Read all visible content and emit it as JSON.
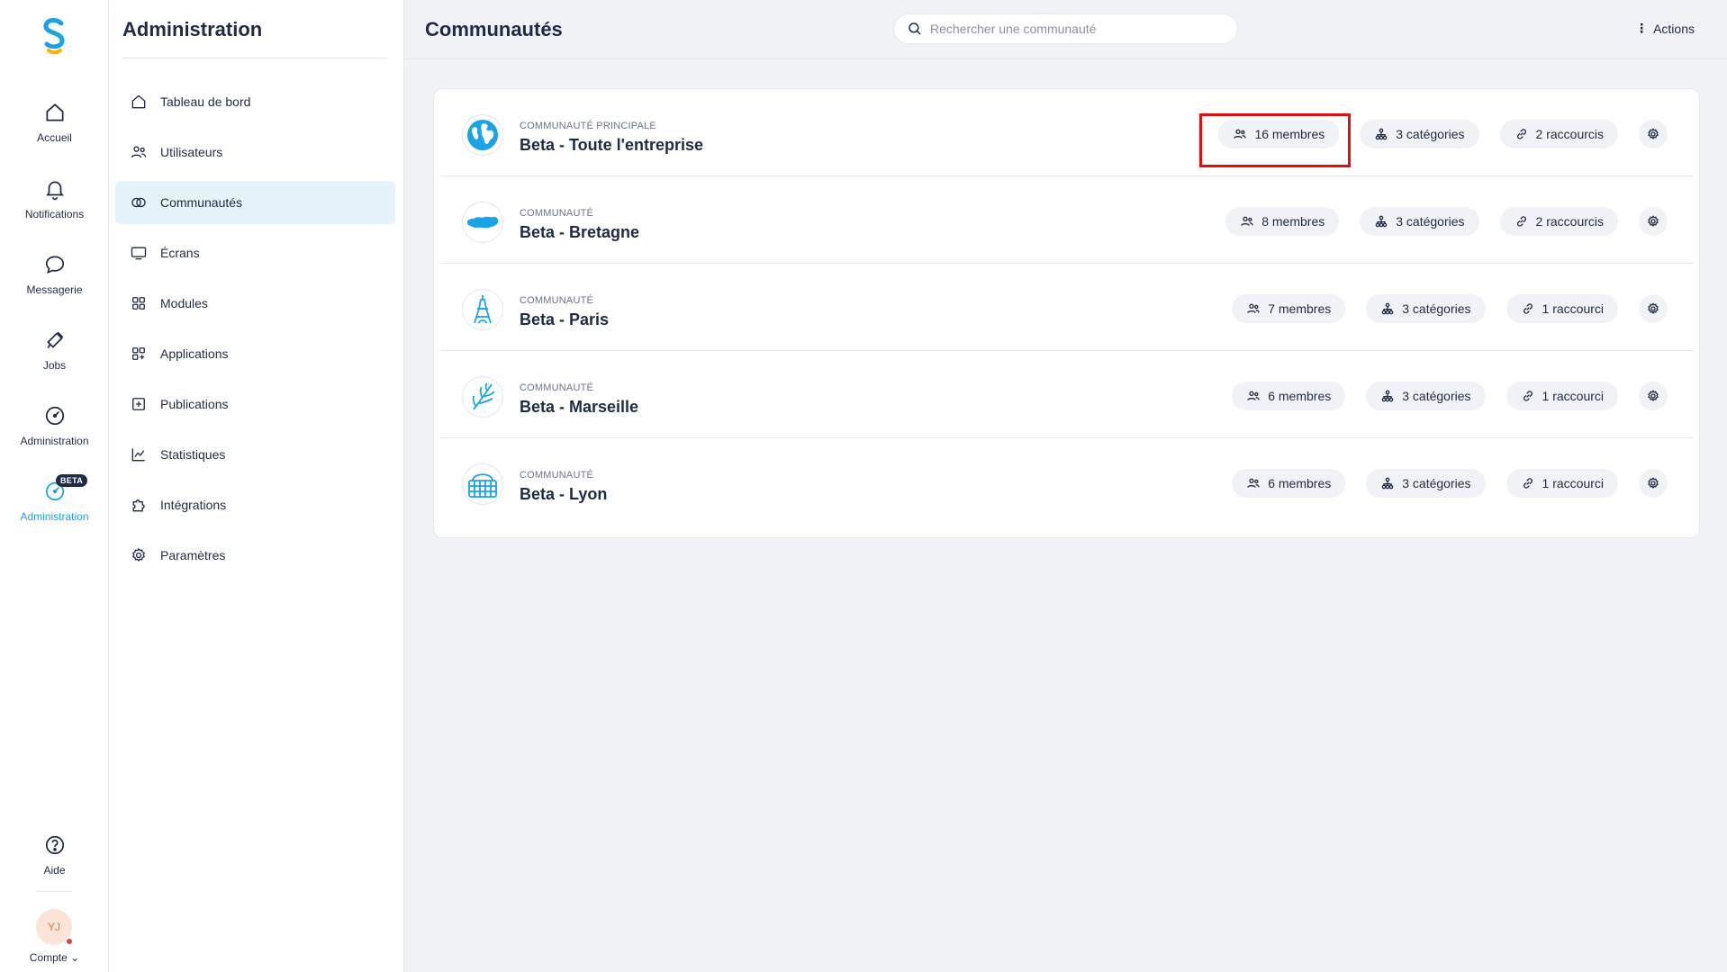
{
  "rail": {
    "items": [
      {
        "label": "Accueil",
        "icon": "home-icon"
      },
      {
        "label": "Notifications",
        "icon": "bell-icon"
      },
      {
        "label": "Messagerie",
        "icon": "chat-icon"
      },
      {
        "label": "Jobs",
        "icon": "megaphone-icon"
      },
      {
        "label": "Administration",
        "icon": "gauge-icon"
      },
      {
        "label": "Administration",
        "icon": "gauge-icon",
        "badge": "BETA",
        "active": true
      }
    ],
    "help_label": "Aide",
    "avatar_initials": "YJ",
    "account_label": "Compte ⌄"
  },
  "sidebar": {
    "title": "Administration",
    "items": [
      {
        "label": "Tableau de bord",
        "icon": "home-icon"
      },
      {
        "label": "Utilisateurs",
        "icon": "users-icon"
      },
      {
        "label": "Communautés",
        "icon": "rings-icon",
        "active": true
      },
      {
        "label": "Écrans",
        "icon": "monitor-icon"
      },
      {
        "label": "Modules",
        "icon": "grid-icon"
      },
      {
        "label": "Applications",
        "icon": "apps-icon"
      },
      {
        "label": "Publications",
        "icon": "plus-square-icon"
      },
      {
        "label": "Statistiques",
        "icon": "chart-icon"
      },
      {
        "label": "Intégrations",
        "icon": "puzzle-icon"
      },
      {
        "label": "Paramètres",
        "icon": "gear-icon"
      }
    ]
  },
  "header": {
    "title": "Communautés",
    "search_placeholder": "Rechercher une communauté",
    "actions_label": "Actions"
  },
  "communities": [
    {
      "type": "Communauté principale",
      "name": "Beta - Toute l'entreprise",
      "members": "16 membres",
      "categories": "3 catégories",
      "shortcuts": "2 raccourcis",
      "icon": "globe-icon"
    },
    {
      "type": "Communauté",
      "name": "Beta - Bretagne",
      "members": "8 membres",
      "categories": "3 catégories",
      "shortcuts": "2 raccourcis",
      "icon": "bretagne-map-icon"
    },
    {
      "type": "Communauté",
      "name": "Beta - Paris",
      "members": "7 membres",
      "categories": "3 catégories",
      "shortcuts": "1 raccourci",
      "icon": "eiffel-tower-icon"
    },
    {
      "type": "Communauté",
      "name": "Beta - Marseille",
      "members": "6 membres",
      "categories": "3 catégories",
      "shortcuts": "1 raccourci",
      "icon": "wheat-icon"
    },
    {
      "type": "Communauté",
      "name": "Beta - Lyon",
      "members": "6 membres",
      "categories": "3 catégories",
      "shortcuts": "1 raccourci",
      "icon": "basket-icon"
    }
  ],
  "colors": {
    "accent": "#1aa3e6",
    "text": "#1f2a44",
    "highlight": "#e01010"
  }
}
